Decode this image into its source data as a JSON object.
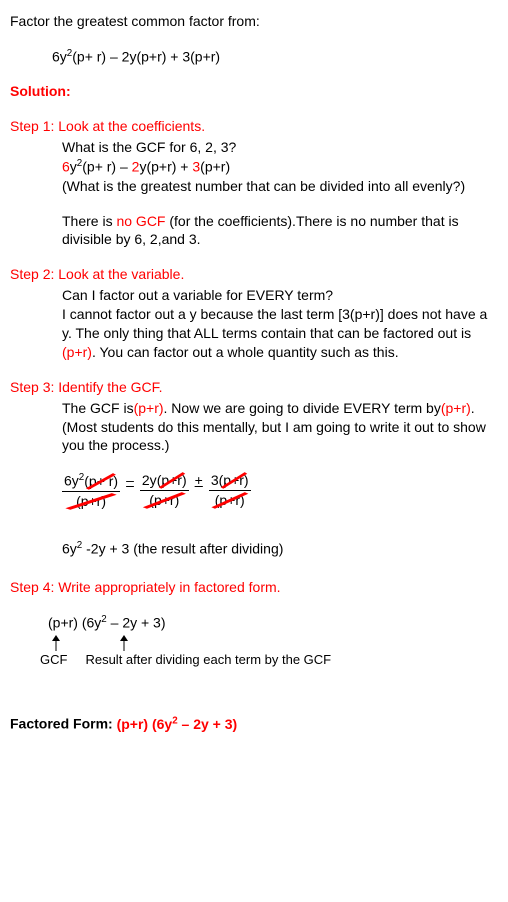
{
  "problem": {
    "title": "Factor the greatest common factor from:",
    "expression_parts": {
      "t1a": "6y",
      "t1b": "(p+ r)",
      "t1c": " – 2y(p+r) + 3(p+r)"
    }
  },
  "solution_label": "Solution:",
  "step1": {
    "title": "Step 1:  Look at the coefficients.",
    "line1": "What is the GCF for  6, 2, 3?",
    "exp": {
      "a": "6",
      "b": "y",
      "c": "(p+ r) – ",
      "d": "2",
      "e": "y(p+r) + ",
      "f": "3",
      "g": "(p+r)"
    },
    "line3": "(What is the greatest number that can be divided into all evenly?)",
    "line4a": "There is ",
    "line4b": "no GCF",
    "line4c": " (for the coefficients).There is no number that is divisible by 6, 2,and 3."
  },
  "step2": {
    "title": "Step 2:  Look at the variable.",
    "line1": "Can I factor out a variable for EVERY term?",
    "line2a": "I cannot factor out a y because the last term [3(p+r)] does not have a y.  The only thing that ALL terms contain that can be factored out is ",
    "line2b": "(p+r)",
    "line2c": ".   You can factor out a whole quantity such as this."
  },
  "step3": {
    "title": "Step 3:  Identify the GCF.",
    "line1a": "The GCF is",
    "line1b": "(p+r)",
    "line1c": ".   Now we are going to divide EVERY term by",
    "line1d": "(p+r)",
    "line1e": ".  (Most students do this mentally, but I am going to write it out to show you the process.)",
    "frac": {
      "n1a": "6y",
      "n1b": "(p+ r)",
      "op1": "–",
      "n2a": "2y",
      "n2b": "(p+r)",
      "op2": "+",
      "n3a": "3",
      "n3b": "(p+r)",
      "den": "(p+r)"
    },
    "result_a": "6y",
    "result_b": "  -2y + 3 (the result after dividing)"
  },
  "step4": {
    "title": "Step 4:  Write appropriately in factored form.",
    "expr_a": "(p+r) (6y",
    "expr_b": " – 2y + 3)",
    "label_gcf": "GCF",
    "label_result": "Result after dividing each term by the GCF"
  },
  "final": {
    "label": "Factored Form:  ",
    "answer_a": "(p+r) (6y",
    "answer_b": " – 2y + 3)"
  }
}
